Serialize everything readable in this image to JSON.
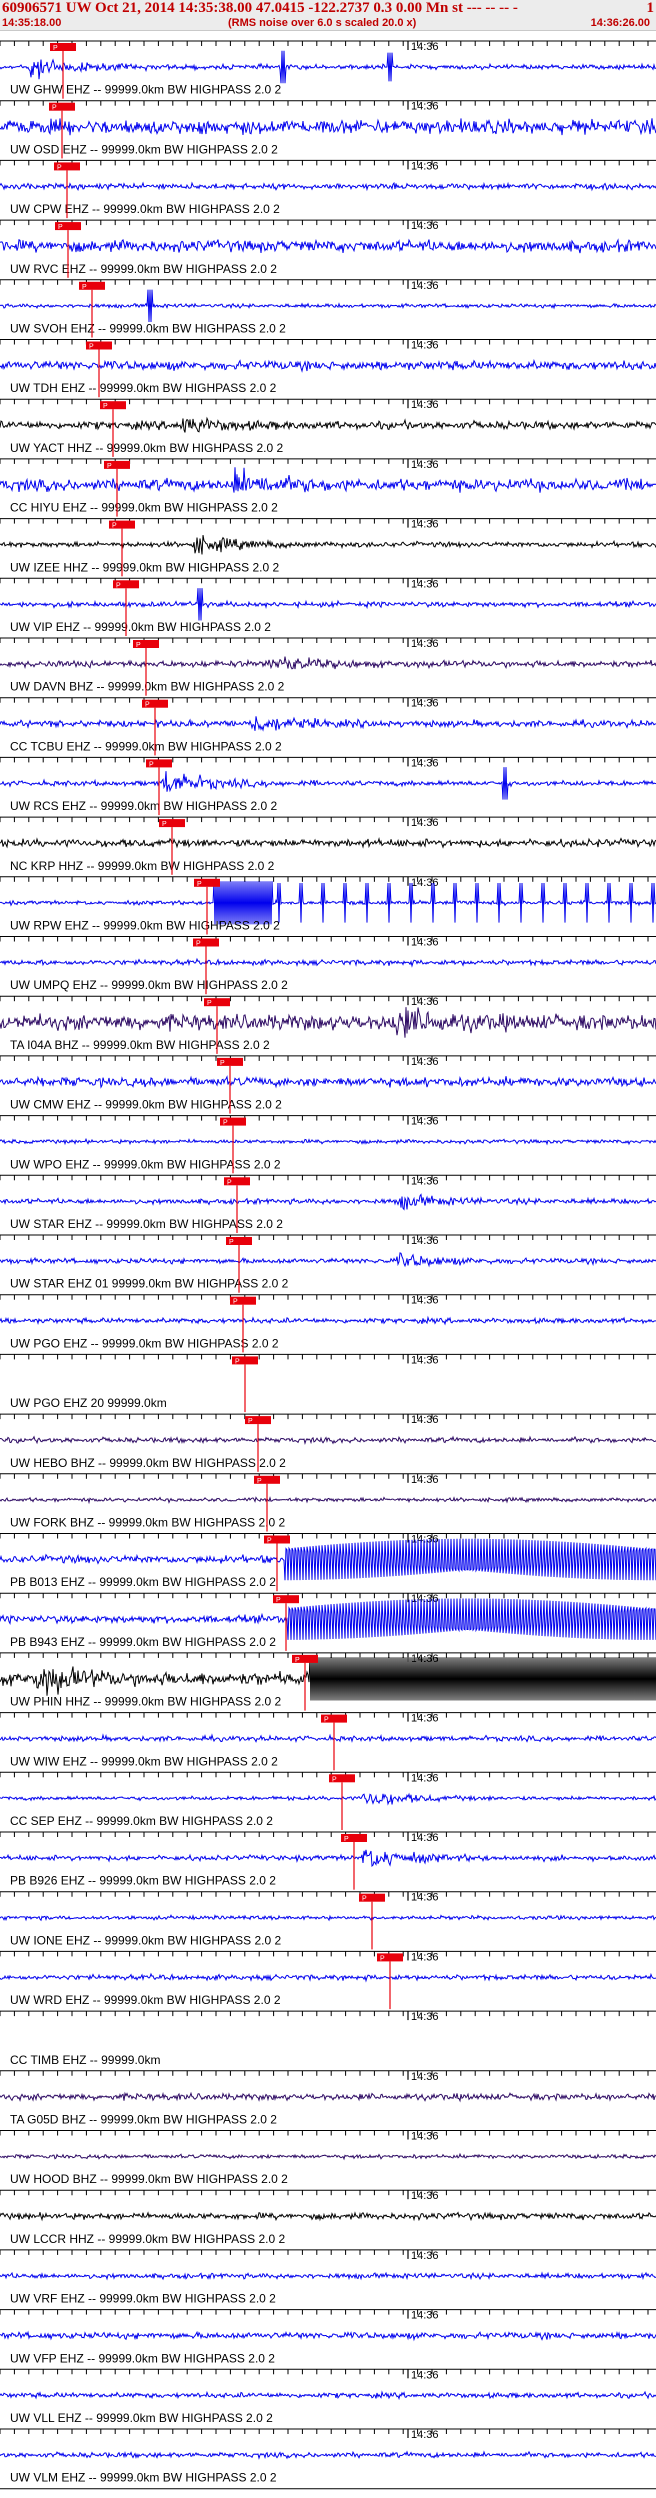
{
  "header": {
    "title": "60906571 UW Oct 21, 2014 14:35:38.00   47.0415 -122.2737  0.3 0.00 Mn st --- -- -- -",
    "right": "1",
    "start_time": "14:35:18.00",
    "note": "(RMS noise over 6.0 s scaled 20.0 x)",
    "end_time": "14:36:26.00"
  },
  "colors": {
    "header_text": "#c00000",
    "pick": "#e8000b",
    "blue": "#0000ee",
    "purple": "#2d0a63",
    "black": "#000000"
  },
  "chart_data": {
    "type": "line",
    "title": "60906571 UW Oct 21, 2014 14:35:38.00   47.0415 -122.2737  0.3 0.00 Mn st --- -- -- -",
    "subtitle": "(RMS noise over 6.0 s scaled 20.0 x)",
    "xlim": [
      "14:35:18.00",
      "14:36:26.00"
    ],
    "minute_mark": "14:36",
    "traces": [
      {
        "label": "UW GHW EHZ -- 99999.0km BW  HIGHPASS  2.0  2",
        "color": "blue",
        "amp": 0.18,
        "pick": 63,
        "burst": 28,
        "burst_amp": 1.0,
        "spike": 283,
        "spike2": 390
      },
      {
        "label": "UW OSD EHZ -- 99999.0km BW  HIGHPASS  2.0  2",
        "color": "blue",
        "amp": 0.55,
        "pick": 62
      },
      {
        "label": "UW CPW EHZ -- 99999.0km BW  HIGHPASS  2.0  2",
        "color": "blue",
        "amp": 0.22,
        "pick": 67
      },
      {
        "label": "UW RVC EHZ -- 99999.0km BW  HIGHPASS  2.0  2",
        "color": "blue",
        "amp": 0.45,
        "pick": 68
      },
      {
        "label": "UW SVOH EHZ -- 99999.0km BW  HIGHPASS  2.0  2",
        "color": "blue",
        "amp": 0.15,
        "pick": 92,
        "spike": 150
      },
      {
        "label": "UW TDH EHZ -- 99999.0km BW  HIGHPASS  2.0  2",
        "color": "blue",
        "amp": 0.35,
        "pick": 99
      },
      {
        "label": "UW YACT HHZ -- 99999.0km BW  HIGHPASS  2.0  2",
        "color": "black",
        "amp": 0.3,
        "pick": 113,
        "burst": 180,
        "burst_amp": 0.6
      },
      {
        "label": "CC HIYU EHZ -- 99999.0km BW  HIGHPASS  2.0  2",
        "color": "blue",
        "amp": 0.45,
        "pick": 117,
        "burst": 235,
        "burst_amp": 0.9
      },
      {
        "label": "UW IZEE HHZ -- 99999.0km BW  HIGHPASS  2.0  2",
        "color": "black",
        "amp": 0.2,
        "pick": 122,
        "burst": 195,
        "burst_amp": 0.7
      },
      {
        "label": "UW VIP EHZ -- 99999.0km BW  HIGHPASS  2.0  2",
        "color": "blue",
        "amp": 0.2,
        "pick": 126,
        "spike": 200
      },
      {
        "label": "UW DAVN BHZ -- 99999.0km BW  HIGHPASS  2.0  2",
        "color": "purple",
        "amp": 0.25,
        "pick": 146,
        "burst": 270,
        "burst_amp": 0.6
      },
      {
        "label": "CC TCBU EHZ -- 99999.0km BW  HIGHPASS  2.0  2",
        "color": "blue",
        "amp": 0.25,
        "pick": 155,
        "burst": 250,
        "burst_amp": 0.7
      },
      {
        "label": "UW RCS EHZ -- 99999.0km BW  HIGHPASS  2.0  2",
        "color": "blue",
        "amp": 0.2,
        "pick": 159,
        "burst": 165,
        "burst_amp": 1.0,
        "spike": 505
      },
      {
        "label": "NC KRP HHZ -- 99999.0km BW  HIGHPASS  2.0  2",
        "color": "black",
        "amp": 0.3,
        "pick": 172
      },
      {
        "label": "UW RPW EHZ -- 99999.0km BW  HIGHPASS  2.0  2",
        "color": "blue",
        "amp": 0.15,
        "pick": 207,
        "block_start": 214,
        "block_end": 272,
        "pulse_start": 278,
        "pulse_end": 656
      },
      {
        "label": "UW UMPQ EHZ -- 99999.0km BW  HIGHPASS  2.0  2",
        "color": "blue",
        "amp": 0.2,
        "pick": 206
      },
      {
        "label": "TA I04A BHZ -- 99999.0km BW  HIGHPASS  2.0  2",
        "color": "purple",
        "amp": 0.6,
        "pick": 217,
        "burst": 395,
        "burst_amp": 1.0
      },
      {
        "label": "UW CMW EHZ -- 99999.0km BW  HIGHPASS  2.0  2",
        "color": "blue",
        "amp": 0.35,
        "pick": 230
      },
      {
        "label": "UW WPO EHZ -- 99999.0km BW  HIGHPASS  2.0  2",
        "color": "blue",
        "amp": 0.15,
        "pick": 233
      },
      {
        "label": "UW STAR EHZ -- 99999.0km BW  HIGHPASS  2.0  2",
        "color": "blue",
        "amp": 0.2,
        "pick": 237,
        "burst": 400,
        "burst_amp": 0.5
      },
      {
        "label": "UW STAR EHZ 01 99999.0km BW  HIGHPASS  2.0  2",
        "color": "blue",
        "amp": 0.2,
        "pick": 239,
        "burst": 400,
        "burst_amp": 0.5
      },
      {
        "label": "UW PGO EHZ -- 99999.0km BW  HIGHPASS  2.0  2",
        "color": "blue",
        "amp": 0.2,
        "pick": 243
      },
      {
        "label": "UW PGO EHZ 20 99999.0km",
        "color": "black",
        "amp": 0.0,
        "pick": 245,
        "flat": true
      },
      {
        "label": "UW HEBO BHZ -- 99999.0km BW  HIGHPASS  2.0  2",
        "color": "purple",
        "amp": 0.2,
        "pick": 258
      },
      {
        "label": "UW FORK BHZ -- 99999.0km BW  HIGHPASS  2.0  2",
        "color": "purple",
        "amp": 0.15,
        "pick": 267
      },
      {
        "label": "PB B013 EHZ -- 99999.0km BW  HIGHPASS  2.0  2",
        "color": "blue",
        "amp": 0.3,
        "pick": 277,
        "block_start": 285,
        "block_end": 656,
        "block_kind": "sine"
      },
      {
        "label": "PB B943 EHZ -- 99999.0km BW  HIGHPASS  2.0  2",
        "color": "blue",
        "amp": 0.3,
        "pick": 286,
        "block_start": 288,
        "block_end": 656,
        "block_kind": "sine"
      },
      {
        "label": "UW PHIN HHZ -- 99999.0km BW  HIGHPASS  2.0  2",
        "color": "black",
        "amp": 0.5,
        "pick": 305,
        "burst": 40,
        "burst_amp": 1.0,
        "block_start": 310,
        "block_end": 656
      },
      {
        "label": "UW WIW EHZ -- 99999.0km BW  HIGHPASS  2.0  2",
        "color": "blue",
        "amp": 0.2,
        "pick": 334
      },
      {
        "label": "CC SEP EHZ -- 99999.0km BW  HIGHPASS  2.0  2",
        "color": "blue",
        "amp": 0.15,
        "pick": 342,
        "burst": 365,
        "burst_amp": 0.7
      },
      {
        "label": "PB B926 EHZ -- 99999.0km BW  HIGHPASS  2.0  2",
        "color": "blue",
        "amp": 0.2,
        "pick": 354,
        "burst": 365,
        "burst_amp": 0.9
      },
      {
        "label": "UW IONE EHZ -- 99999.0km BW  HIGHPASS  2.0  2",
        "color": "blue",
        "amp": 0.15,
        "pick": 372
      },
      {
        "label": "UW WRD EHZ -- 99999.0km BW  HIGHPASS  2.0  2",
        "color": "blue",
        "amp": 0.2,
        "pick": 390
      },
      {
        "label": "CC TIMB EHZ -- 99999.0km",
        "color": "black",
        "amp": 0.0,
        "flat": true
      },
      {
        "label": "TA G05D BHZ -- 99999.0km BW  HIGHPASS  2.0  2",
        "color": "purple",
        "amp": 0.25
      },
      {
        "label": "UW HOOD BHZ -- 99999.0km BW  HIGHPASS  2.0  2",
        "color": "purple",
        "amp": 0.15
      },
      {
        "label": "UW LCCR HHZ -- 99999.0km BW  HIGHPASS  2.0  2",
        "color": "black",
        "amp": 0.25
      },
      {
        "label": "UW VRF EHZ -- 99999.0km BW  HIGHPASS  2.0  2",
        "color": "blue",
        "amp": 0.2
      },
      {
        "label": "UW VFP EHZ -- 99999.0km BW  HIGHPASS  2.0  2",
        "color": "blue",
        "amp": 0.25
      },
      {
        "label": "UW VLL EHZ -- 99999.0km BW  HIGHPASS  2.0  2",
        "color": "blue",
        "amp": 0.2
      },
      {
        "label": "UW VLM EHZ -- 99999.0km BW  HIGHPASS  2.0  2",
        "color": "blue",
        "amp": 0.2
      }
    ]
  }
}
